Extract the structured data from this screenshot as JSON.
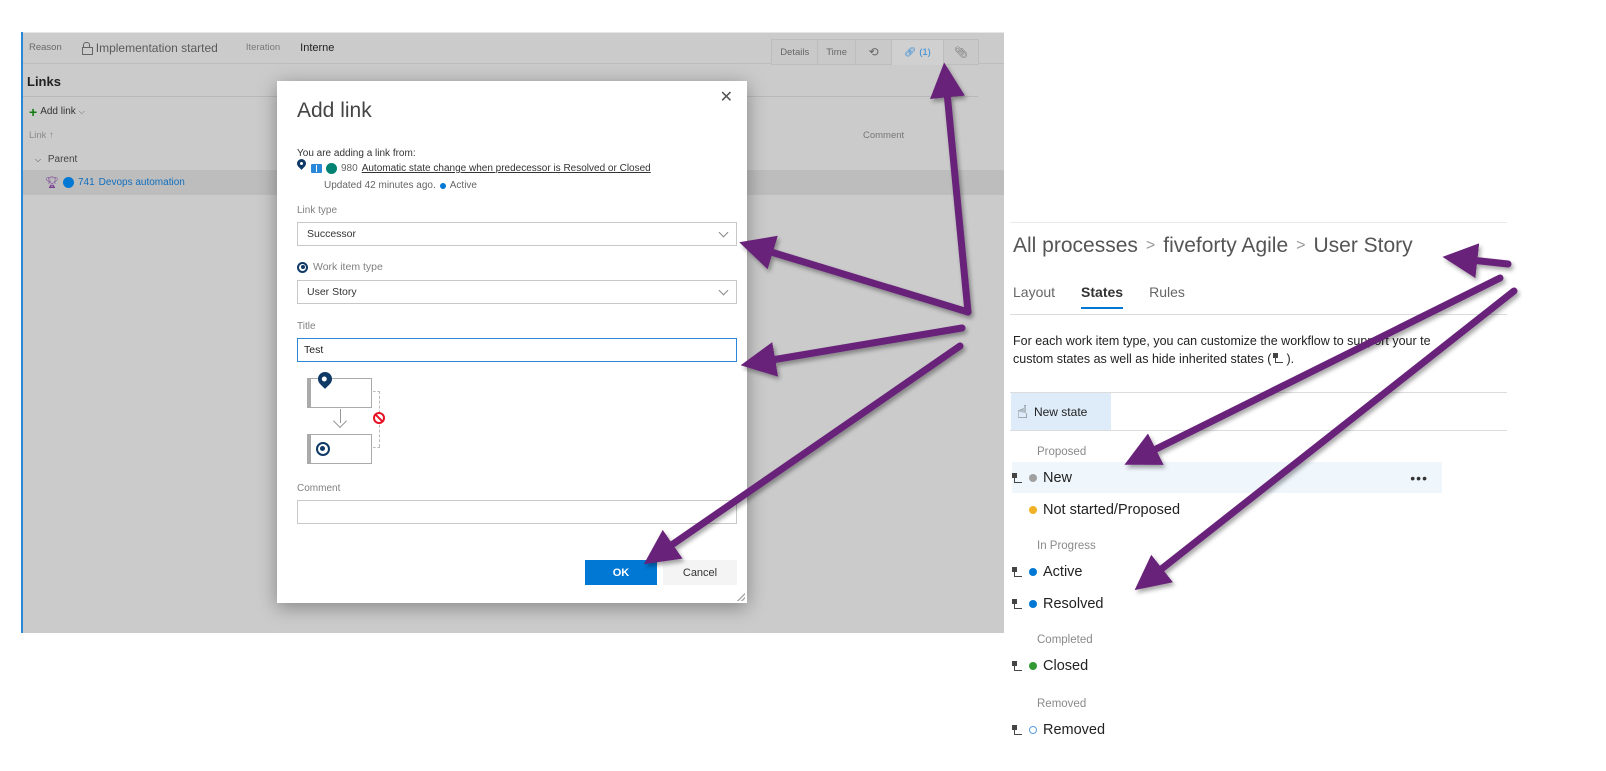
{
  "work_item": {
    "reason_label": "Reason",
    "reason_value": "Implementation started",
    "iteration_label": "Iteration",
    "iteration_value": "Interne",
    "tabs": [
      {
        "label": "Details"
      },
      {
        "label": "Time"
      },
      {
        "label": "",
        "icon": "history-icon"
      },
      {
        "label": "(1)",
        "icon": "link-icon",
        "active": true
      },
      {
        "label": "",
        "icon": "attachment-icon"
      }
    ],
    "links_title": "Links",
    "add_link_label": "Add link",
    "column_link": "Link",
    "column_comment": "Comment",
    "group_parent": "Parent",
    "parent_item": {
      "id": "741",
      "title": "Devops automation",
      "badge_color": "#0078d4",
      "icon_color": "#773b93"
    }
  },
  "dialog": {
    "title": "Add link",
    "from_label": "You are adding a link from:",
    "source_item": {
      "id": "980",
      "title": "Automatic state change when predecessor is Resolved or Closed",
      "badge_color": "#008272"
    },
    "updated_text": "Updated 42 minutes ago.",
    "state_text": "Active",
    "state_color": "#0078d4",
    "link_type_label": "Link type",
    "link_type_value": "Successor",
    "work_item_type_label": "Work item type",
    "work_item_type_value": "User Story",
    "title_label": "Title",
    "title_value": "Test",
    "comment_label": "Comment",
    "comment_value": "",
    "ok_label": "OK",
    "cancel_label": "Cancel",
    "primary_color": "#0078d4"
  },
  "process": {
    "breadcrumb": [
      "All processes",
      "fiveforty Agile",
      "User Story"
    ],
    "tabs": [
      {
        "label": "Layout"
      },
      {
        "label": "States",
        "active": true
      },
      {
        "label": "Rules"
      }
    ],
    "description_line1": "For each work item type, you can customize the workflow to support your te",
    "description_line2": "custom states as well as hide inherited states (",
    "description_suffix": ").",
    "new_state_label": "New state",
    "categories": [
      {
        "name": "Proposed",
        "states": [
          {
            "name": "New",
            "color": "#a0a0a0",
            "inherited": true,
            "highlighted": true
          },
          {
            "name": "Not started/Proposed",
            "color": "#f2b225",
            "inherited": false
          }
        ]
      },
      {
        "name": "In Progress",
        "states": [
          {
            "name": "Active",
            "color": "#0078d4",
            "inherited": true
          },
          {
            "name": "Resolved",
            "color": "#0078d4",
            "inherited": true
          }
        ]
      },
      {
        "name": "Completed",
        "states": [
          {
            "name": "Closed",
            "color": "#339933",
            "inherited": true
          }
        ]
      },
      {
        "name": "Removed",
        "states": [
          {
            "name": "Removed",
            "color": "#5a9de0",
            "inherited": true,
            "hollow": true
          }
        ]
      }
    ],
    "more_actions": "•••"
  },
  "annotations": {
    "arrow_color": "#68217a"
  }
}
